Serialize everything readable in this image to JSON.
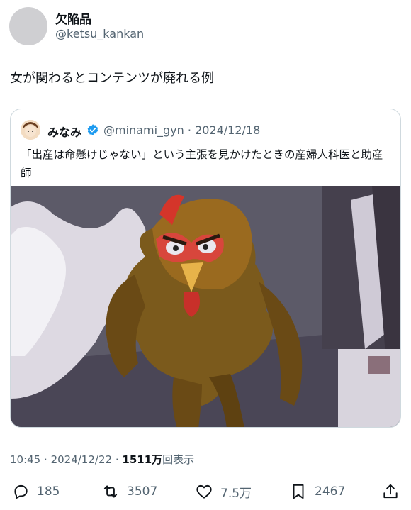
{
  "author": {
    "display_name": "欠陥品",
    "handle": "@ketsu_kankan"
  },
  "tweet": {
    "text": "女が関わるとコンテンツが廃れる例"
  },
  "quote": {
    "display_name": "みなみ",
    "verified_icon": "verified-badge-icon",
    "handle": "@minami_gyn",
    "separator": "·",
    "date": "2024/12/18",
    "text": "「出産は命懸けじゃない」という主張を見かけたときの産婦人科医と助産師",
    "image_description_icon": "angry-rooster-mask-image"
  },
  "meta": {
    "time": "10:45",
    "separator1": "·",
    "date": "2024/12/22",
    "separator2": "·",
    "views_count": "1511万",
    "views_label": "回表示"
  },
  "actions": {
    "reply_icon": "reply-icon",
    "reply_count": "185",
    "retweet_icon": "retweet-icon",
    "retweet_count": "3507",
    "like_icon": "heart-icon",
    "like_count": "7.5万",
    "bookmark_icon": "bookmark-icon",
    "bookmark_count": "2467",
    "share_icon": "share-icon"
  },
  "colors": {
    "text_primary": "#0f1419",
    "text_secondary": "#536471",
    "border": "#cfd9de",
    "verified": "#1d9bf0"
  }
}
